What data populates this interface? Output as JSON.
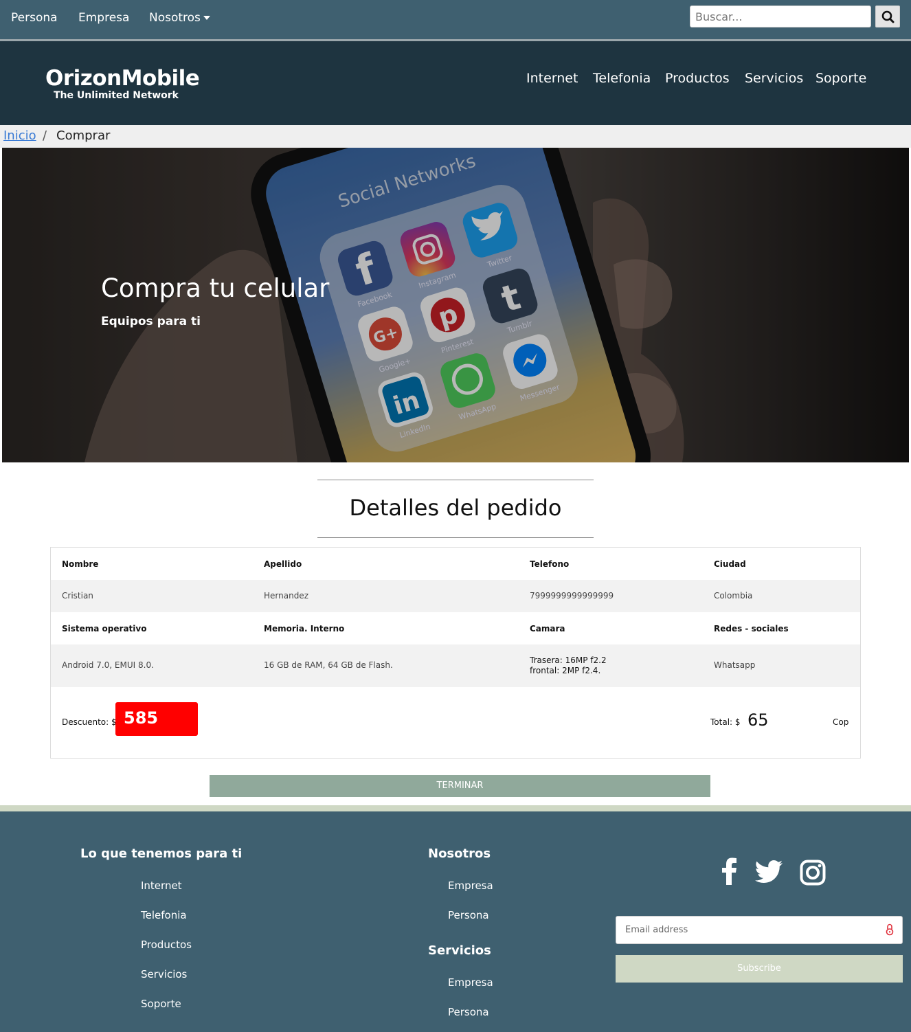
{
  "topbar": {
    "nav": [
      "Persona",
      "Empresa",
      "Nosotros"
    ],
    "search_placeholder": "Buscar..."
  },
  "header": {
    "brand": "OrizonMobile",
    "tagline": "The Unlimited Network",
    "nav": [
      "Internet",
      "Telefonia",
      "Productos",
      "Servicios",
      "Soporte"
    ]
  },
  "breadcrumb": {
    "home": "Inicio",
    "separator": "/",
    "current": "Comprar"
  },
  "hero": {
    "title": "Compra tu celular",
    "subtitle": "Equipos para ti",
    "screen_text": "Social Networks",
    "app_labels": [
      "Facebook",
      "Instagram",
      "Twitter",
      "Google+",
      "Pinterest",
      "Tumblr",
      "LinkedIn",
      "WhatsApp",
      "Messenger"
    ]
  },
  "order": {
    "title": "Detalles del pedido",
    "headers1": [
      "Nombre",
      "Apellido",
      "Telefono",
      "Ciudad"
    ],
    "values1": [
      "Cristian",
      "Hernandez",
      "7999999999999999",
      "Colombia"
    ],
    "headers2": [
      "Sistema operativo",
      "Memoria. Interno",
      "Camara",
      "Redes - sociales"
    ],
    "values2": {
      "os": "Android 7.0, EMUI 8.0.",
      "memory": "16 GB de RAM, 64 GB de Flash.",
      "camera_rear": "Trasera: 16MP f2.2",
      "camera_front": "frontal: 2MP f2.4.",
      "social": "Whatsapp"
    },
    "discount_label": "Descuento: $",
    "discount_value": "585",
    "total_label": "Total: $",
    "total_value": "65",
    "currency": "Cop",
    "finish_label": "TERMINAR"
  },
  "footer": {
    "col1_title": "Lo que tenemos para ti",
    "col1_links": [
      "Internet",
      "Telefonia",
      "Productos",
      "Servicios",
      "Soporte"
    ],
    "col2_title": "Nosotros",
    "col2_links": [
      "Empresa",
      "Persona"
    ],
    "col3_title": "Servicios",
    "col3_links": [
      "Empresa",
      "Persona"
    ],
    "email_placeholder": "Email address",
    "subscribe_label": "Subscribe",
    "social_icons": [
      "facebook-icon",
      "twitter-icon",
      "instagram-icon"
    ]
  },
  "colors": {
    "topbar": "#3f6070",
    "header": "#1e3440",
    "discount": "#ff0000",
    "finish_button": "#90a99b",
    "footer": "#3f6070",
    "footer_accent": "#cfd8c4"
  }
}
